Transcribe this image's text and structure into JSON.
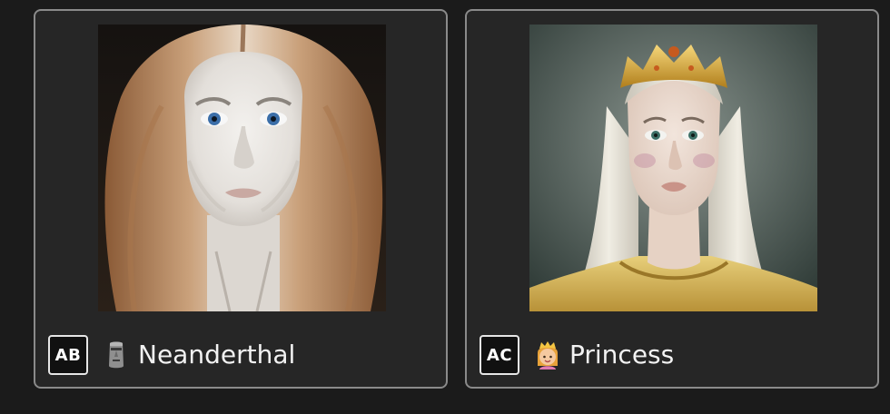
{
  "cards": [
    {
      "code": "AB",
      "emoji": "🗿",
      "emoji_icon": "moai-icon",
      "name": "Neanderthal",
      "image": "neanderthal-portrait"
    },
    {
      "code": "AC",
      "emoji": "👸",
      "emoji_icon": "princess-icon",
      "name": "Princess",
      "image": "princess-portrait"
    }
  ],
  "colors": {
    "background": "#1b1b1b",
    "card_background": "#262626",
    "card_border": "#8a8a8a",
    "badge_border": "#e6e6e6",
    "text": "#f2f2f2"
  }
}
